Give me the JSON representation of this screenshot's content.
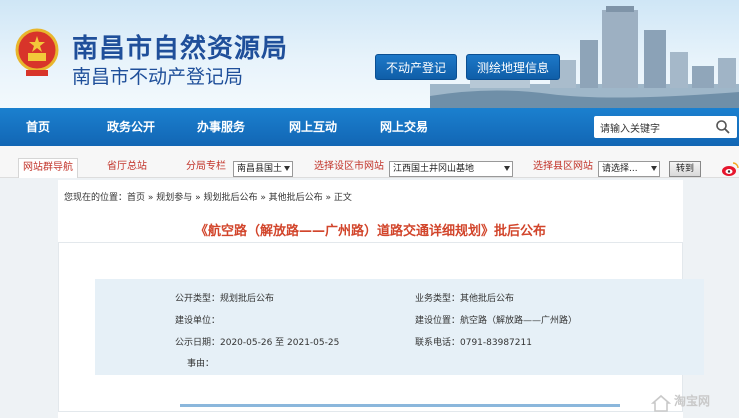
{
  "header": {
    "title": "南昌市自然资源局",
    "subtitle": "南昌市不动产登记局",
    "buttons": [
      "不动产登记",
      "测绘地理信息"
    ]
  },
  "nav": {
    "items": [
      "首页",
      "政务公开",
      "办事服务",
      "网上互动",
      "网上交易"
    ],
    "search_placeholder": "请输入关键字"
  },
  "subbar": {
    "tabs": [
      "网站群导航",
      "省厅总站",
      "分局专栏",
      "选择设区市网站",
      "选择县区网站"
    ],
    "select_branch": "南昌县国土",
    "select_city": "江西国土井冈山基地",
    "select_county": "请选择...",
    "go_label": "转到"
  },
  "breadcrumb": "您现在的位置：首页 » 规划参与 » 规划批后公布 » 其他批后公布 » 正文",
  "article": {
    "title": "《航空路（解放路——广州路）道路交通详细规划》批后公布",
    "fields": {
      "pub_type": "公开类型：规划批后公布",
      "biz_type": "业务类型：其他批后公布",
      "builder": "建设单位：",
      "location": "建设位置：航空路（解放路——广州路）",
      "date": "公示日期：2020-05-26 至 2021-05-25",
      "phone": "联系电话：0791-83987211",
      "reason": "事由："
    }
  },
  "watermark": "淘宝网",
  "colors": {
    "nav_bg": "#1266b4",
    "title_red": "#d2452b",
    "brand_blue": "#1f4f9a"
  }
}
